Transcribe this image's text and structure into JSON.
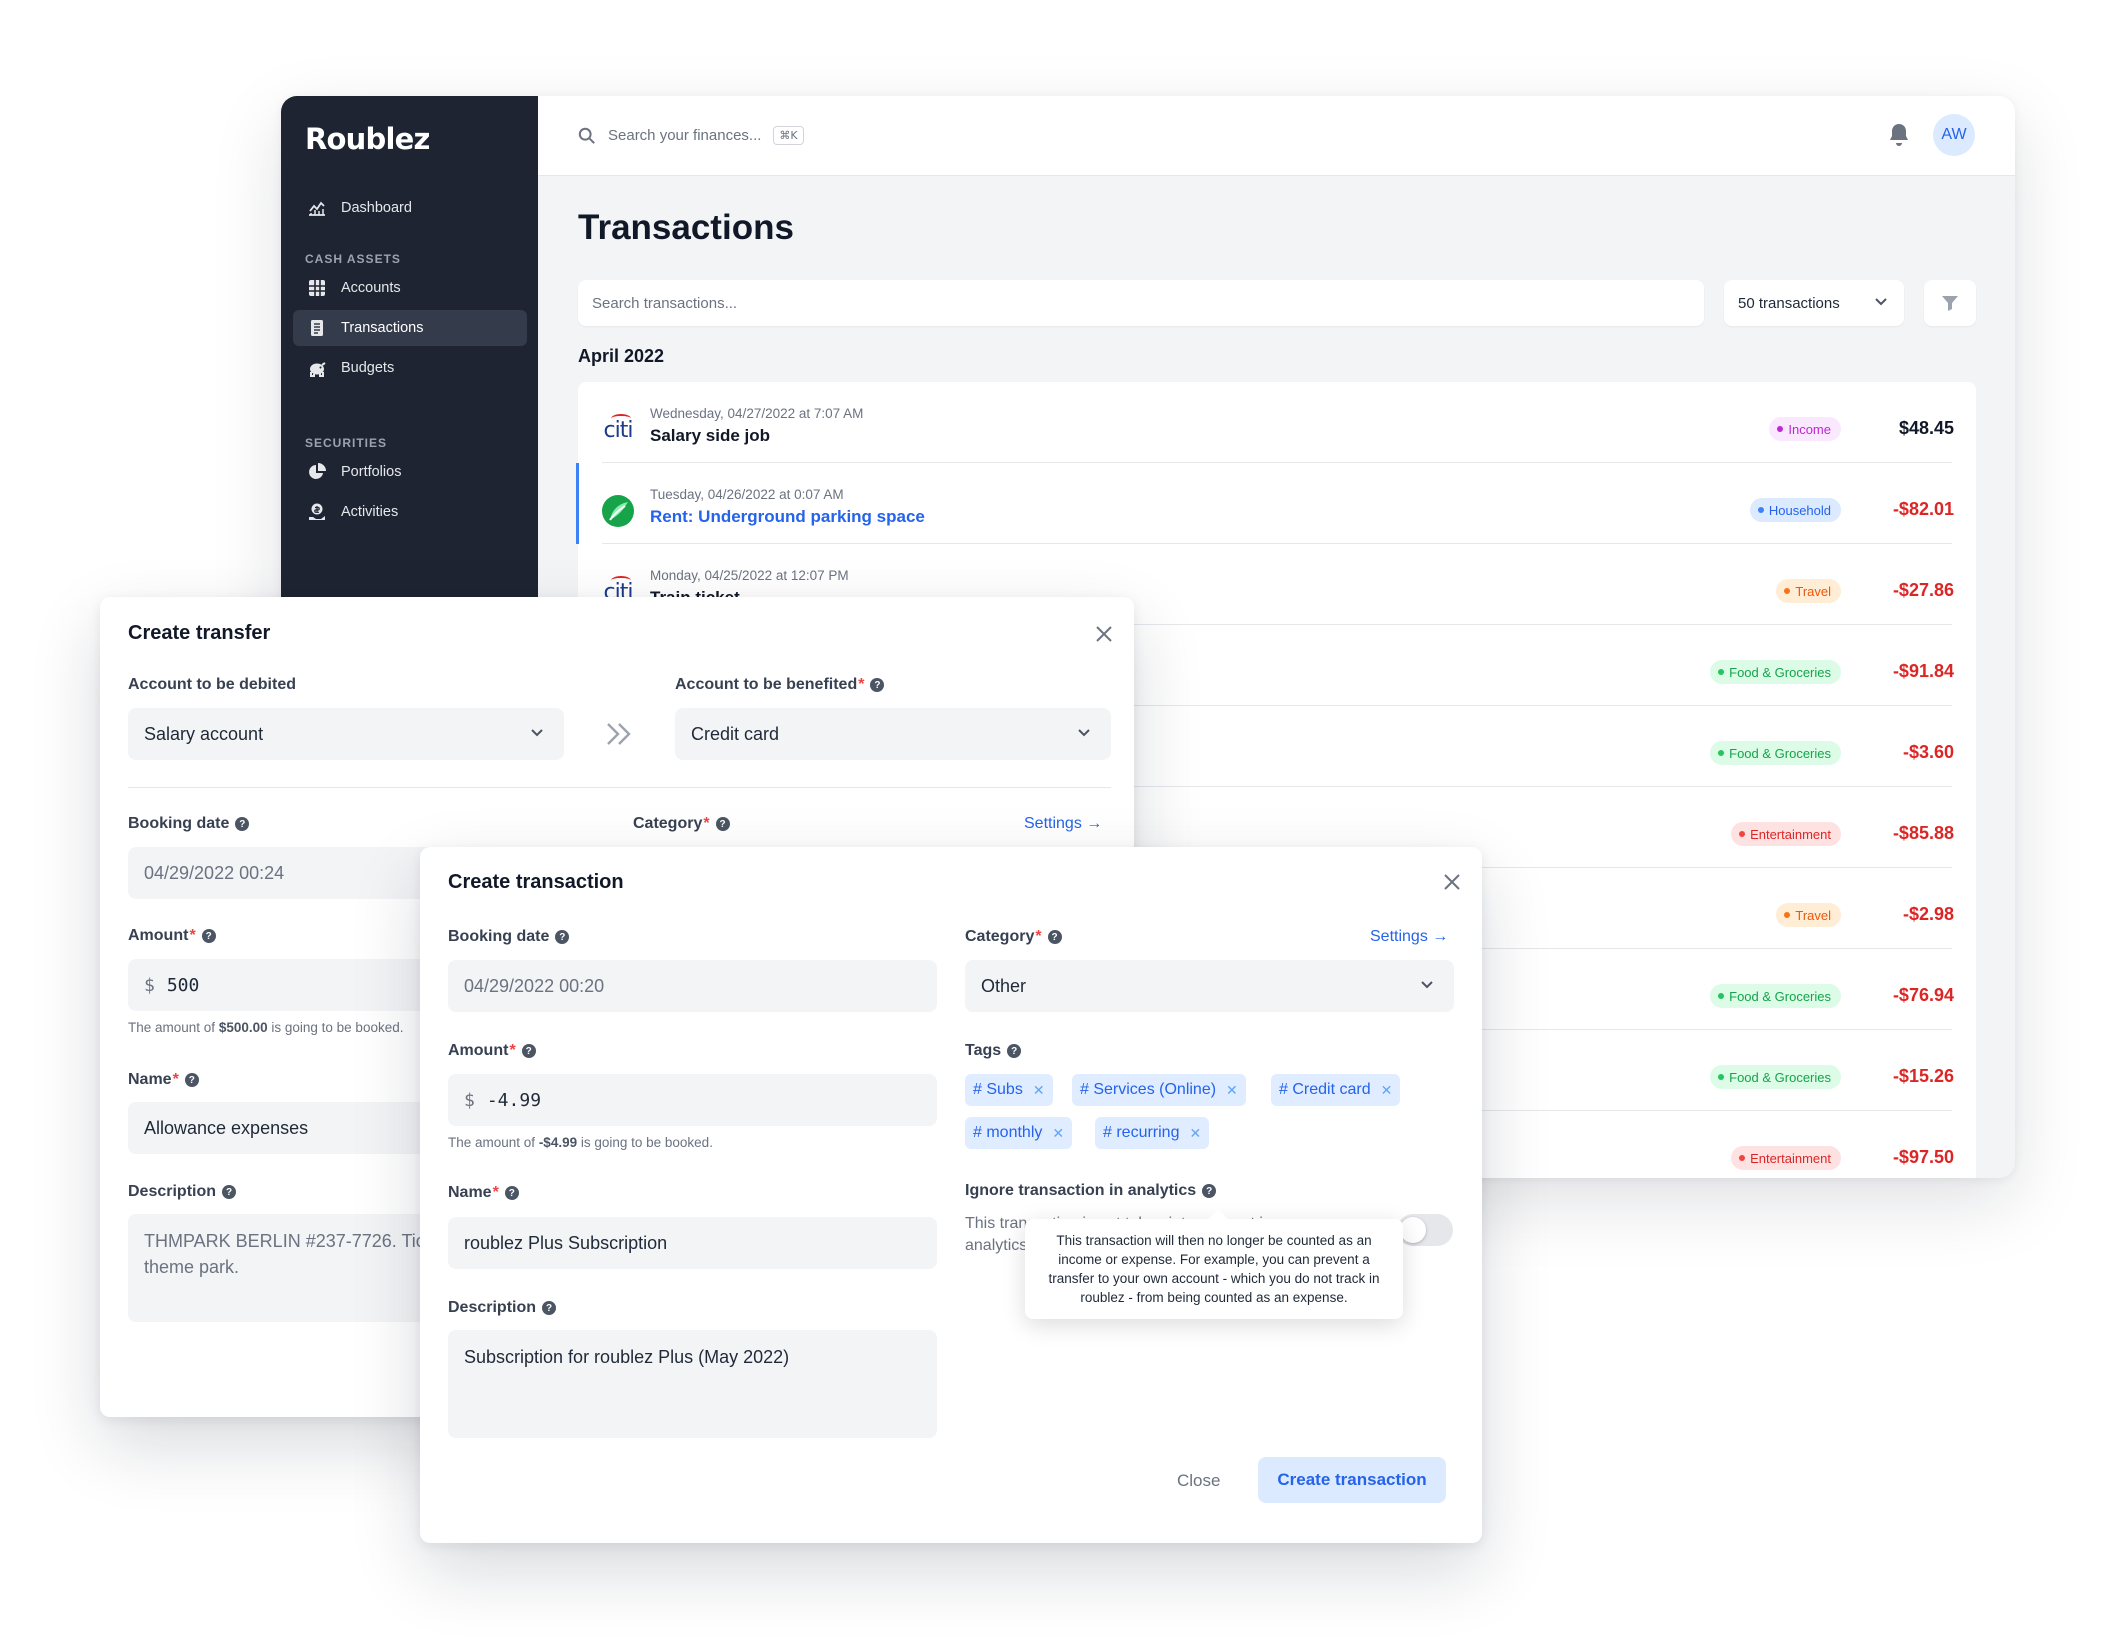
{
  "app": {
    "brand": "Roublez"
  },
  "sidebar": {
    "dashboard": "Dashboard",
    "cash_assets_heading": "CASH ASSETS",
    "accounts": "Accounts",
    "transactions": "Transactions",
    "budgets": "Budgets",
    "securities_heading": "SECURITIES",
    "portfolios": "Portfolios",
    "activities": "Activities"
  },
  "topbar": {
    "search_placeholder": "Search your finances...",
    "shortcut": "⌘K",
    "avatar_initials": "AW"
  },
  "page": {
    "title": "Transactions",
    "search_placeholder": "Search transactions...",
    "count_selector": "50 transactions",
    "month_heading": "April 2022"
  },
  "transactions": [
    {
      "date": "Wednesday, 04/27/2022 at 7:07 AM",
      "name": "Salary side job",
      "category": "Income",
      "amount": "$48.45",
      "logo": "citi",
      "badge": "income",
      "sign": "pos"
    },
    {
      "date": "Tuesday, 04/26/2022 at 0:07 AM",
      "name": "Rent: Underground parking space",
      "category": "Household",
      "amount": "-$82.01",
      "logo": "leaf",
      "badge": "household",
      "sign": "neg",
      "selected": true
    },
    {
      "date": "Monday, 04/25/2022 at 12:07 PM",
      "name": "Train ticket",
      "category": "Travel",
      "amount": "-$27.86",
      "logo": "citi",
      "badge": "travel",
      "sign": "neg"
    },
    {
      "date": "",
      "name": "",
      "category": "Food & Groceries",
      "amount": "-$91.84",
      "badge": "food",
      "sign": "neg"
    },
    {
      "date": "",
      "name": "",
      "category": "Food & Groceries",
      "amount": "-$3.60",
      "badge": "food",
      "sign": "neg"
    },
    {
      "date": "",
      "name": "",
      "category": "Entertainment",
      "amount": "-$85.88",
      "badge": "ent",
      "sign": "neg"
    },
    {
      "date": "",
      "name": "",
      "category": "Travel",
      "amount": "-$2.98",
      "badge": "travel",
      "sign": "neg"
    },
    {
      "date": "",
      "name": "",
      "category": "Food & Groceries",
      "amount": "-$76.94",
      "badge": "food",
      "sign": "neg"
    },
    {
      "date": "",
      "name": "",
      "category": "Food & Groceries",
      "amount": "-$15.26",
      "badge": "food",
      "sign": "neg"
    },
    {
      "date": "",
      "name": "",
      "category": "Entertainment",
      "amount": "-$97.50",
      "badge": "ent",
      "sign": "neg"
    }
  ],
  "transfer_dialog": {
    "title": "Create transfer",
    "debit_label": "Account to be debited",
    "debit_value": "Salary account",
    "benefit_label": "Account to be benefited",
    "benefit_value": "Credit card",
    "booking_label": "Booking date",
    "booking_value": "04/29/2022 00:24",
    "category_label": "Category",
    "settings_link": "Settings →",
    "amount_label": "Amount",
    "currency": "$",
    "amount_value": "500",
    "hint_prefix": "The amount of ",
    "hint_amount": "$500.00",
    "hint_suffix": " is going to be booked.",
    "name_label": "Name",
    "name_value": "Allowance expenses",
    "description_label": "Description",
    "description_value": "THMPARK BERLIN #237-7726. Ticket for the theme park."
  },
  "transaction_dialog": {
    "title": "Create transaction",
    "booking_label": "Booking date",
    "booking_value": "04/29/2022 00:20",
    "category_label": "Category",
    "settings_link": "Settings →",
    "category_value": "Other",
    "amount_label": "Amount",
    "currency": "$",
    "amount_value": "-4.99",
    "hint_prefix": "The amount of ",
    "hint_amount": "-$4.99",
    "hint_suffix": " is going to be booked.",
    "tags_label": "Tags",
    "tags": [
      "# Subs",
      "# Services (Online)",
      "# Credit card",
      "# monthly",
      "# recurring"
    ],
    "name_label": "Name",
    "name_value": "roublez Plus Subscription",
    "description_label": "Description",
    "description_value": "Subscription for roublez Plus (May 2022)",
    "ignore_label": "Ignore transaction in analytics",
    "ignore_desc": "This transaction is not taken into account in analytics.",
    "tooltip": "This transaction will then no longer be counted as an income or expense. For example, you can prevent a transfer to your own account - which you do not track in roublez - from being counted as an expense.",
    "close_button": "Close",
    "create_button": "Create transaction"
  },
  "colors": {
    "sidebar_bg": "#1e2431",
    "accent": "#2563eb",
    "negative": "#dc2626"
  }
}
